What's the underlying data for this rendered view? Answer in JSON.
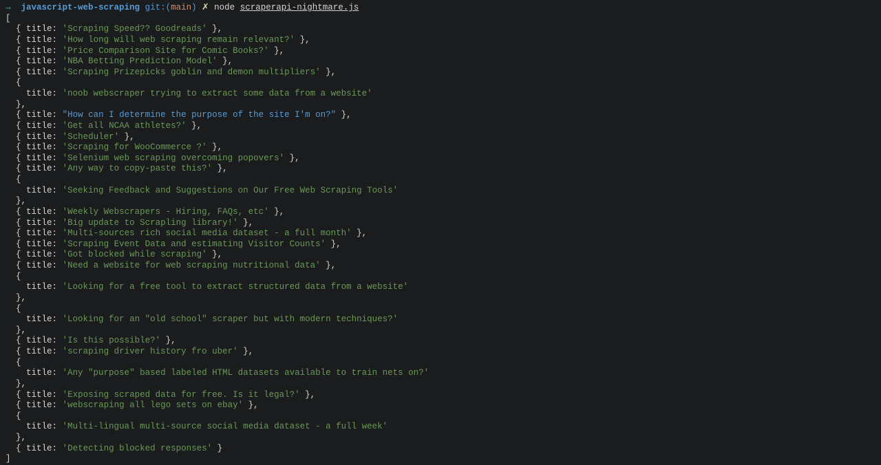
{
  "prompt": {
    "arrow": "→",
    "directory": "javascript-web-scraping",
    "git_label": "git:",
    "branch": "main",
    "x": "✗",
    "command": "node",
    "arg": "scraperapi-nightmare.js"
  },
  "entries": [
    {
      "title": "Scraping Speed?? Goodreads",
      "inline": true
    },
    {
      "title": "How long will web scraping remain relevant?",
      "inline": true
    },
    {
      "title": "Price Comparison Site for Comic Books?",
      "inline": true
    },
    {
      "title": "NBA Betting Prediction Model",
      "inline": true
    },
    {
      "title": "Scraping Prizepicks goblin and demon multipliers",
      "inline": true
    },
    {
      "title": "noob webscraper trying to extract some data from a website",
      "inline": false
    },
    {
      "title": "How can I determine the purpose of the site I'm on?",
      "inline": true,
      "dq": true
    },
    {
      "title": "Get all NCAA athletes?",
      "inline": true
    },
    {
      "title": "Scheduler",
      "inline": true
    },
    {
      "title": "Scraping for WooCommerce ?",
      "inline": true
    },
    {
      "title": "Selenium web scraping overcoming popovers",
      "inline": true
    },
    {
      "title": "Any way to copy-paste this?",
      "inline": true
    },
    {
      "title": "Seeking Feedback and Suggestions on Our Free Web Scraping Tools",
      "inline": false
    },
    {
      "title": "Weekly Webscrapers - Hiring, FAQs, etc",
      "inline": true
    },
    {
      "title": "Big update to Scrapling library!",
      "inline": true
    },
    {
      "title": "Multi-sources rich social media dataset - a full month",
      "inline": true
    },
    {
      "title": "Scraping Event Data and estimating Visitor Counts",
      "inline": true
    },
    {
      "title": "Got blocked while scraping",
      "inline": true
    },
    {
      "title": "Need a website for web scraping nutritional data",
      "inline": true
    },
    {
      "title": "Looking for a free tool to extract structured data from a website",
      "inline": false
    },
    {
      "title": "Looking for an \"old school\" scraper but with modern techniques?",
      "inline": false
    },
    {
      "title": "Is this possible?",
      "inline": true
    },
    {
      "title": "scraping driver history fro uber",
      "inline": true
    },
    {
      "title": "Any \"purpose\" based labeled HTML datasets available to train nets on?",
      "inline": false
    },
    {
      "title": "Exposing scraped data for free. Is it legal?",
      "inline": true
    },
    {
      "title": "webscraping all lego sets on ebay",
      "inline": true
    },
    {
      "title": "Multi-lingual multi-source social media dataset - a full week",
      "inline": false
    },
    {
      "title": "Detecting blocked responses",
      "inline": true,
      "last": true
    }
  ]
}
